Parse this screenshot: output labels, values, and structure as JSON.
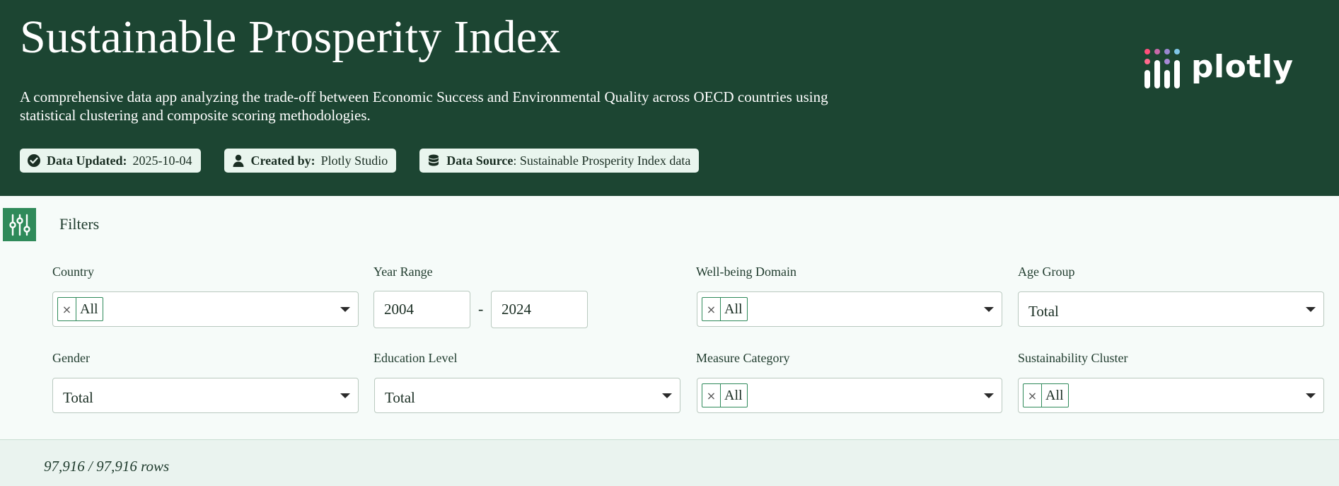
{
  "header": {
    "title": "Sustainable Prosperity Index",
    "description": "A comprehensive data app analyzing the trade-off between Economic Success and Environmental Quality across OECD countries using statistical clustering and composite scoring methodologies.",
    "badges": {
      "updated_label": "Data Updated:",
      "updated_value": "2025-10-04",
      "created_label": "Created by:",
      "created_value": "Plotly Studio",
      "source_label": "Data Source",
      "source_value": ": Sustainable Prosperity Index data"
    },
    "logo_text": "plotly"
  },
  "filters": {
    "heading": "Filters",
    "country": {
      "label": "Country",
      "tag": "All",
      "remove": "×"
    },
    "year_range": {
      "label": "Year Range",
      "start": "2004",
      "end": "2024",
      "separator": "-"
    },
    "wellbeing_domain": {
      "label": "Well-being Domain",
      "tag": "All",
      "remove": "×"
    },
    "age_group": {
      "label": "Age Group",
      "value": "Total"
    },
    "gender": {
      "label": "Gender",
      "value": "Total"
    },
    "education_level": {
      "label": "Education Level",
      "value": "Total"
    },
    "measure_category": {
      "label": "Measure Category",
      "tag": "All",
      "remove": "×"
    },
    "sustainability_cluster": {
      "label": "Sustainability Cluster",
      "tag": "All",
      "remove": "×"
    }
  },
  "status": {
    "rows": "97,916 / 97,916 rows"
  },
  "colors": {
    "header_bg": "#1c4532",
    "accent": "#2f8a5a",
    "badge_bg": "#e9f5ee"
  }
}
